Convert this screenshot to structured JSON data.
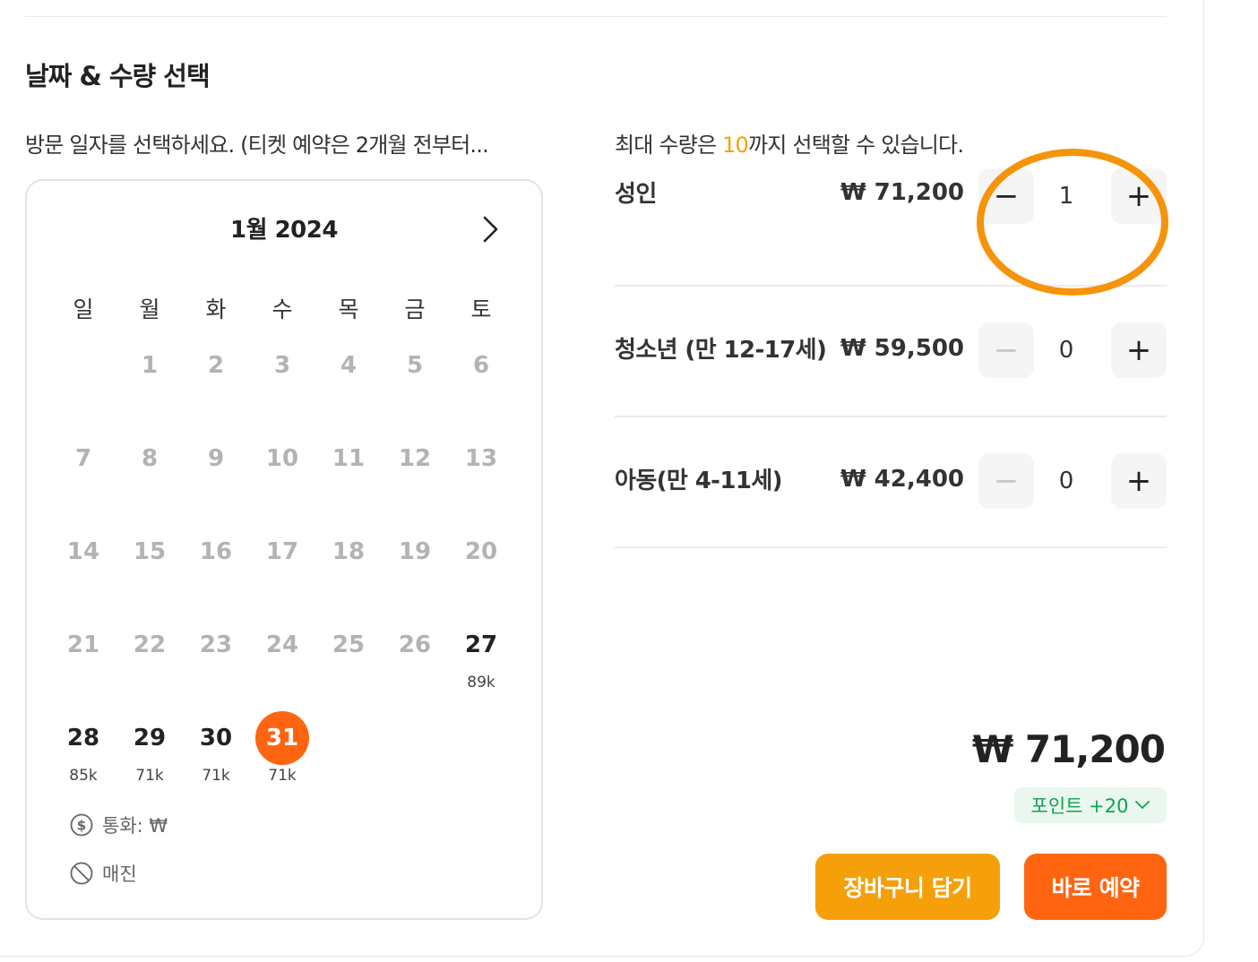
{
  "section": {
    "title": "날짜 & 수량 선택",
    "visit_hint": "방문 일자를 선택하세요. (티켓 예약은 2개월 전부터..."
  },
  "calendar": {
    "month_label": "1월 2024",
    "next_icon": "chevron-right-icon",
    "weekdays": [
      "일",
      "월",
      "화",
      "수",
      "목",
      "금",
      "토"
    ],
    "days": [
      {
        "day": "1",
        "available": false
      },
      {
        "day": "2",
        "available": false
      },
      {
        "day": "3",
        "available": false
      },
      {
        "day": "4",
        "available": false
      },
      {
        "day": "5",
        "available": false
      },
      {
        "day": "6",
        "available": false
      },
      {
        "day": "7",
        "available": false
      },
      {
        "day": "8",
        "available": false
      },
      {
        "day": "9",
        "available": false
      },
      {
        "day": "10",
        "available": false
      },
      {
        "day": "11",
        "available": false
      },
      {
        "day": "12",
        "available": false
      },
      {
        "day": "13",
        "available": false
      },
      {
        "day": "14",
        "available": false
      },
      {
        "day": "15",
        "available": false
      },
      {
        "day": "16",
        "available": false
      },
      {
        "day": "17",
        "available": false
      },
      {
        "day": "18",
        "available": false
      },
      {
        "day": "19",
        "available": false
      },
      {
        "day": "20",
        "available": false
      },
      {
        "day": "21",
        "available": false
      },
      {
        "day": "22",
        "available": false
      },
      {
        "day": "23",
        "available": false
      },
      {
        "day": "24",
        "available": false
      },
      {
        "day": "25",
        "available": false
      },
      {
        "day": "26",
        "available": false
      },
      {
        "day": "27",
        "available": true,
        "price": "89k"
      },
      {
        "day": "28",
        "available": true,
        "price": "85k"
      },
      {
        "day": "29",
        "available": true,
        "price": "71k"
      },
      {
        "day": "30",
        "available": true,
        "price": "71k"
      },
      {
        "day": "31",
        "available": true,
        "price": "71k",
        "selected": true
      }
    ],
    "legend": {
      "currency": "통화: ₩",
      "sold_out": "매진"
    }
  },
  "quantity": {
    "max_prefix": "최대 수량은",
    "max_value": "10",
    "max_suffix": "까지 선택할 수 있습니다.",
    "rows": [
      {
        "label": "성인",
        "price": "₩ 71,200",
        "qty": "1",
        "minus_enabled": true
      },
      {
        "label": "청소년 (만 12-17세)",
        "price": "₩ 59,500",
        "qty": "0",
        "minus_enabled": false
      },
      {
        "label": "아동(만 4-11세)",
        "price": "₩ 42,400",
        "qty": "0",
        "minus_enabled": false
      }
    ],
    "minus_symbol": "−",
    "plus_symbol": "+"
  },
  "summary": {
    "total": "₩ 71,200",
    "points": "포인트 +20"
  },
  "actions": {
    "cart": "장바구니 담기",
    "book": "바로 예약"
  },
  "colors": {
    "accent_orange": "#ff6410",
    "accent_amber": "#f5a00a",
    "points_green": "#11a14f"
  }
}
